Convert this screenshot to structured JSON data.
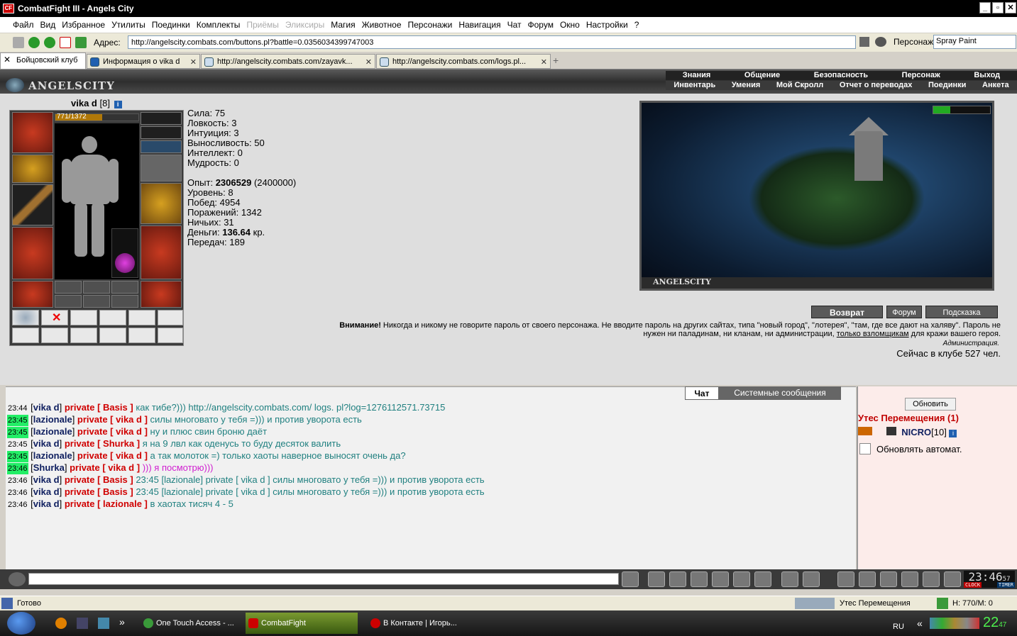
{
  "window": {
    "title": "CombatFight III - Angels City",
    "app_icon_label": "CF",
    "btn_min": "_",
    "btn_max": "▫",
    "btn_close": "✕"
  },
  "menu": [
    {
      "label": "Файл",
      "disabled": false
    },
    {
      "label": "Вид",
      "disabled": false
    },
    {
      "label": "Избранное",
      "disabled": false
    },
    {
      "label": "Утилиты",
      "disabled": false
    },
    {
      "label": "Поединки",
      "disabled": false
    },
    {
      "label": "Комплекты",
      "disabled": false
    },
    {
      "label": "Приёмы",
      "disabled": true
    },
    {
      "label": "Эликсиры",
      "disabled": true
    },
    {
      "label": "Магия",
      "disabled": false
    },
    {
      "label": "Животное",
      "disabled": false
    },
    {
      "label": "Персонажи",
      "disabled": false
    },
    {
      "label": "Навигация",
      "disabled": false
    },
    {
      "label": "Чат",
      "disabled": false
    },
    {
      "label": "Форум",
      "disabled": false
    },
    {
      "label": "Окно",
      "disabled": false
    },
    {
      "label": "Настройки",
      "disabled": false
    },
    {
      "label": "?",
      "disabled": false
    }
  ],
  "address": {
    "label": "Адрес:",
    "url": "http://angelscity.combats.com/buttons.pl?battle=0.0356034399747003",
    "persona_label": "Персонаж:",
    "persona_value": "Spray Paint"
  },
  "tabs": [
    {
      "label": "Бойцовский клуб"
    },
    {
      "label": "Информация о vika d"
    },
    {
      "label": "http://angelscity.combats.com/zayavk..."
    },
    {
      "label": "http://angelscity.combats.com/logs.pl..."
    }
  ],
  "tab_close": "✕",
  "game_logo": "ANGELSCITY",
  "top_nav_row1": [
    "Знания",
    "Общение",
    "Безопасность",
    "Персонаж",
    "Выход"
  ],
  "top_nav_row2": [
    "Инвентарь",
    "Умения",
    "Мой Скролл",
    "Отчет о переводах",
    "Поединки",
    "Анкета"
  ],
  "character": {
    "name": "vika d",
    "level": "[8]",
    "info_mark": "i",
    "hp_text": "771/1372",
    "hp_fraction": 0.562,
    "stats": [
      {
        "k": "Сила:",
        "v": "75"
      },
      {
        "k": "Ловкость:",
        "v": "3"
      },
      {
        "k": "Интуиция:",
        "v": "3"
      },
      {
        "k": "Выносливость:",
        "v": "50"
      },
      {
        "k": "Интеллект:",
        "v": "0"
      },
      {
        "k": "Мудрость:",
        "v": "0"
      }
    ],
    "exp_label": "Опыт:",
    "exp_value": "2306529",
    "exp_next": "(2400000)",
    "level_label": "Уровень:",
    "level_value": "8",
    "wins_label": "Побед:",
    "wins_value": "4954",
    "losses_label": "Поражений:",
    "losses_value": "1342",
    "draws_label": "Ничьих:",
    "draws_value": "31",
    "money_label": "Деньги:",
    "money_value": "136.64",
    "money_unit": "кр.",
    "transfers_label": "Передач:",
    "transfers_value": "189"
  },
  "scene_caption": "ANGELSCITY",
  "buttons": {
    "back": "Возврат",
    "forum": "Форум",
    "hint": "Подсказка"
  },
  "warning": {
    "bold": "Внимание!",
    "text1": " Никогда и никому не говорите пароль от своего персонажа. Не вводите пароль на других сайтах, типа \"новый город\", \"лотерея\", \"там, где все дают на халяву\". Пароль не нужен ни паладинам, ни кланам, ни администрации, ",
    "link": "только взломщикам",
    "text2": " для кражи вашего героя.",
    "admin": "Администрация."
  },
  "online_text": "Сейчас в клубе 527 чел.",
  "chat_tabs": {
    "chat": "Чат",
    "system": "Системные сообщения"
  },
  "messages": [
    {
      "t": "23:44",
      "hl": false,
      "nick": "vika d",
      "pv": "private [ Basis ]",
      "text": "как тибе?))) http://angelscity.combats.com/ logs. pl?log=1276112571.73715",
      "pink": false
    },
    {
      "t": "23:45",
      "hl": true,
      "nick": "lazionale",
      "pv": "private [ vika d ]",
      "text": "силы многовато у тебя =))) и против уворота есть",
      "pink": false
    },
    {
      "t": "23:45",
      "hl": true,
      "nick": "lazionale",
      "pv": "private [ vika d ]",
      "text": "ну и плюс свин броню даёт",
      "pink": false
    },
    {
      "t": "23:45",
      "hl": false,
      "nick": "vika d",
      "pv": "private [ Shurka ]",
      "text": "я на 9 лвл как оденусь то буду десяток валить",
      "pink": false
    },
    {
      "t": "23:45",
      "hl": true,
      "nick": "lazionale",
      "pv": "private [ vika d ]",
      "text": "а так молоток =) только хаоты наверное выносят очень да?",
      "pink": false
    },
    {
      "t": "23:46",
      "hl": true,
      "nick": "Shurka",
      "pv": "private [ vika d ]",
      "text": "))) я посмотрю)))",
      "pink": true
    },
    {
      "t": "23:46",
      "hl": false,
      "nick": "vika d",
      "pv": "private [ Basis ]",
      "text": "23:45 [lazionale] private [ vika d ] силы многовато у тебя =))) и против уворота есть",
      "pink": false
    },
    {
      "t": "23:46",
      "hl": false,
      "nick": "vika d",
      "pv": "private [ Basis ]",
      "text": "23:45 [lazionale] private [ vika d ] силы многовато у тебя =))) и против уворота есть",
      "pink": false
    },
    {
      "t": "23:46",
      "hl": false,
      "nick": "vika d",
      "pv": "private [ lazionale ]",
      "text": "в хаотах тисяч 4 - 5",
      "pink": false
    }
  ],
  "right_panel": {
    "refresh": "Обновить",
    "location": "Утес Перемещения (1)",
    "user_nick": "NICRO",
    "user_level": "[10]",
    "info_mark": "i",
    "auto_label": "Обновлять автомат."
  },
  "clock": {
    "time": "23:46",
    "sec": "57",
    "clock_label": "CLOCK",
    "timer_label": "TIMER"
  },
  "status": {
    "left": "Готово",
    "location": "Утес Перемещения",
    "hp": "Н: 770/М: 0"
  },
  "taskbar": {
    "items": [
      {
        "label": "One Touch Access - ..."
      },
      {
        "label": "CombatFight"
      },
      {
        "label": "В Контакте | Игорь..."
      }
    ],
    "lang": "RU",
    "time": "22",
    "time_small": "47"
  },
  "colors": {
    "nick": "#102060",
    "private": "#d00000",
    "text": "#208080",
    "pink": "#d020d0",
    "location": "#c00000"
  }
}
